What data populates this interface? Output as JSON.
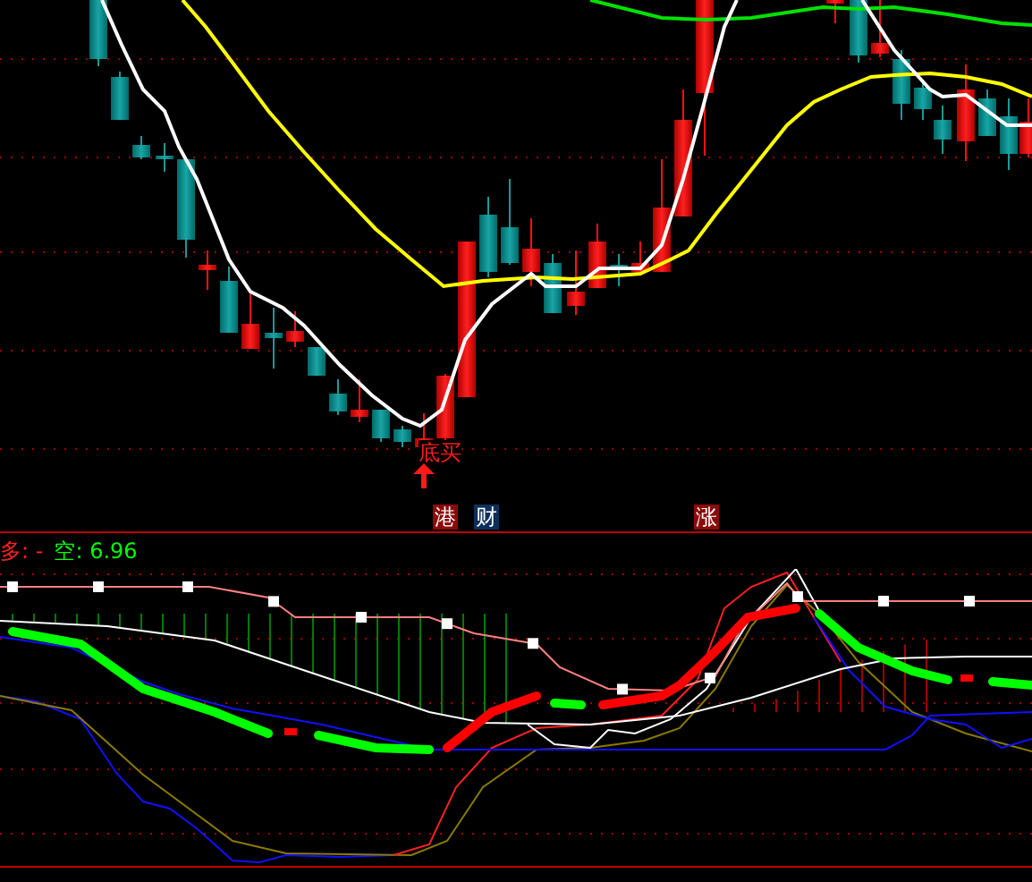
{
  "signals": [
    {
      "label": "底买"
    }
  ],
  "badges": [
    {
      "label": "港",
      "color": "#8b0a0a"
    },
    {
      "label": "财",
      "color": "#0e2f5c"
    },
    {
      "label": "涨",
      "color": "#8b0a0a"
    }
  ],
  "legend": [
    {
      "label": "多:",
      "value": "-",
      "color": "#ff2020"
    },
    {
      "label": "空:",
      "value": "6.96",
      "color": "#00ff00"
    }
  ]
}
